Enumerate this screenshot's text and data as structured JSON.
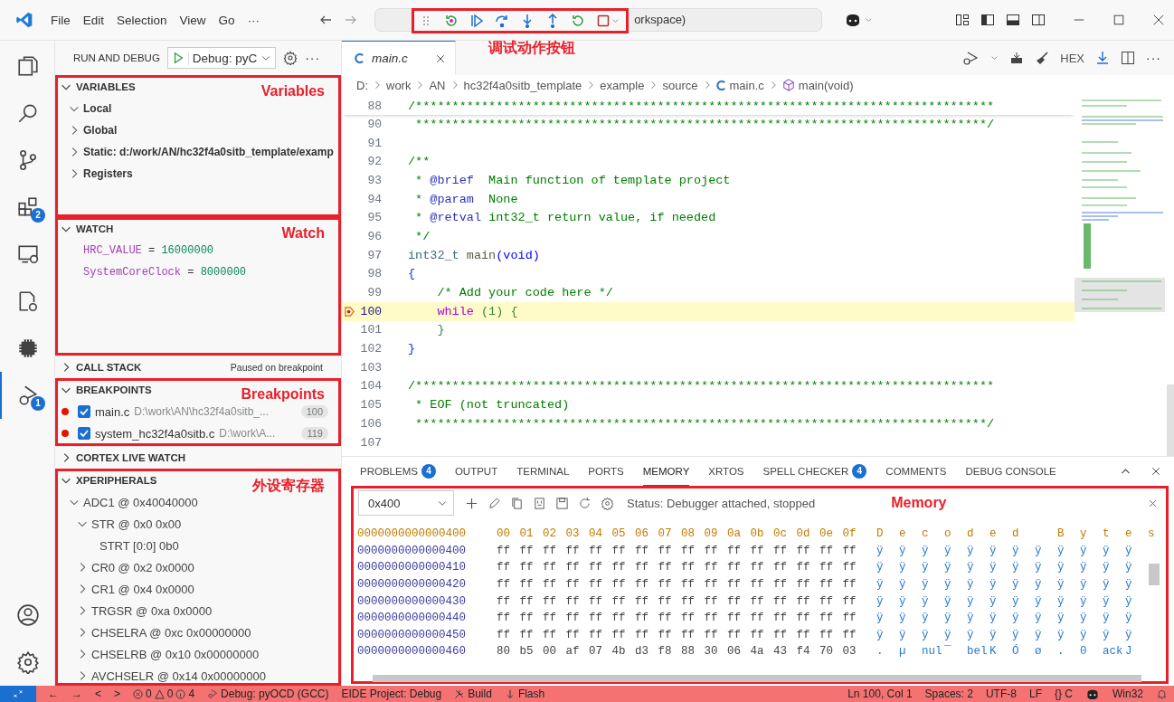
{
  "titlebar": {
    "menu": [
      "File",
      "Edit",
      "Selection",
      "View",
      "Go",
      "···"
    ],
    "command_center": "orkspace)",
    "annotation": "调试动作按钮",
    "debug_toolbar": [
      {
        "kind": "grip"
      },
      {
        "kind": "restart-dot"
      },
      {
        "kind": "continue"
      },
      {
        "kind": "step-over"
      },
      {
        "kind": "step-into"
      },
      {
        "kind": "step-out"
      },
      {
        "kind": "restart"
      },
      {
        "kind": "stop"
      }
    ]
  },
  "activity_bar": [
    {
      "kind": "explorer",
      "selected": false
    },
    {
      "kind": "search",
      "selected": false
    },
    {
      "kind": "source-control",
      "selected": false
    },
    {
      "kind": "extensions",
      "selected": false,
      "badge": "2"
    },
    {
      "kind": "remote",
      "selected": false
    },
    {
      "kind": "cpp-settings",
      "selected": false
    },
    {
      "kind": "chip",
      "selected": false
    },
    {
      "kind": "debug",
      "selected": true,
      "badge": "1"
    }
  ],
  "activity_bottom": [
    {
      "kind": "account"
    },
    {
      "kind": "settings"
    }
  ],
  "sidebar": {
    "title": "RUN AND DEBUG",
    "config": "Debug: pyC",
    "more": "···",
    "sections": [
      {
        "kind": "variables",
        "title": "VARIABLES",
        "expanded": true,
        "annotation": "Variables",
        "items": [
          {
            "label": "Local",
            "expanded": true
          },
          {
            "label": "Global",
            "expanded": false
          },
          {
            "label": "Static: d:/work/AN/hc32f4a0sitb_template/examp",
            "expanded": false
          },
          {
            "label": "Registers",
            "expanded": false
          }
        ]
      },
      {
        "kind": "watch",
        "title": "WATCH",
        "expanded": true,
        "annotation": "Watch",
        "items": [
          {
            "name": "HRC_VALUE",
            "operator": "=",
            "value": "16000000"
          },
          {
            "name": "SystemCoreClock",
            "operator": "=",
            "value": "8000000"
          }
        ]
      },
      {
        "kind": "callstack",
        "title": "CALL STACK",
        "expanded": false,
        "status": "Paused on breakpoint"
      },
      {
        "kind": "breakpoints",
        "title": "BREAKPOINTS",
        "expanded": true,
        "annotation": "Breakpoints",
        "items": [
          {
            "checked": true,
            "file": "main.c",
            "path": "D:\\work\\AN\\hc32f4a0sitb_...",
            "line": "100"
          },
          {
            "checked": true,
            "file": "system_hc32f4a0sitb.c",
            "path": "D:\\work\\A...",
            "line": "119"
          }
        ]
      },
      {
        "kind": "livewatch",
        "title": "CORTEX LIVE WATCH",
        "expanded": false
      },
      {
        "kind": "peripherals",
        "title": "XPERIPHERALS",
        "expanded": true,
        "annotation": "外设寄存器",
        "items": [
          {
            "label": "ADC1 @ 0x40040000",
            "expanded": true,
            "children": [
              {
                "label": "STR @ 0x0 0x00",
                "expanded": true,
                "children": [
                  {
                    "label": "STRT [0:0] 0b0"
                  }
                ]
              },
              {
                "label": "CR0 @ 0x2 0x0000",
                "expanded": false
              },
              {
                "label": "CR1 @ 0x4 0x0000",
                "expanded": false
              },
              {
                "label": "TRGSR @ 0xa 0x0000",
                "expanded": false
              },
              {
                "label": "CHSELRA @ 0xc 0x00000000",
                "expanded": false
              },
              {
                "label": "CHSELRB @ 0x10 0x00000000",
                "expanded": false
              },
              {
                "label": "AVCHSELR @ 0x14 0x00000000",
                "expanded": false
              }
            ]
          }
        ]
      }
    ]
  },
  "editor": {
    "tabs": [
      {
        "label": "main.c",
        "selected": true
      }
    ],
    "toolbar_text": "HEX",
    "more": "···",
    "breadcrumb": [
      {
        "kind": "folder",
        "text": "D:"
      },
      {
        "kind": "folder",
        "text": "work"
      },
      {
        "kind": "folder",
        "text": "AN"
      },
      {
        "kind": "folder",
        "text": "hc32f4a0sitb_template"
      },
      {
        "kind": "folder",
        "text": "example"
      },
      {
        "kind": "folder",
        "text": "source"
      },
      {
        "kind": "c-file",
        "text": "main.c"
      },
      {
        "kind": "function",
        "text": "main(void)"
      }
    ],
    "sticky": {
      "number": "88",
      "tokens": [
        {
          "kind": "comment",
          "text": "/*******************************************************************************"
        }
      ]
    },
    "lines": [
      {
        "number": "90",
        "current": false,
        "breakpoint": false,
        "tokens": [
          {
            "kind": "comment",
            "text": " ******************************************************************************/"
          }
        ]
      },
      {
        "number": "91",
        "current": false,
        "breakpoint": false
      },
      {
        "number": "92",
        "current": false,
        "breakpoint": false,
        "tokens": [
          {
            "kind": "comment",
            "text": "/**"
          }
        ]
      },
      {
        "number": "93",
        "current": false,
        "breakpoint": false,
        "tokens": [
          {
            "kind": "comment",
            "text": " * "
          },
          {
            "kind": "doctag",
            "text": "@brief"
          },
          {
            "kind": "comment",
            "text": "  Main function of template project"
          }
        ]
      },
      {
        "number": "94",
        "current": false,
        "breakpoint": false,
        "tokens": [
          {
            "kind": "comment",
            "text": " * "
          },
          {
            "kind": "doctag",
            "text": "@param"
          },
          {
            "kind": "comment",
            "text": "  None"
          }
        ]
      },
      {
        "number": "95",
        "current": false,
        "breakpoint": false,
        "tokens": [
          {
            "kind": "comment",
            "text": " * "
          },
          {
            "kind": "doctag",
            "text": "@retval"
          },
          {
            "kind": "comment",
            "text": " int32_t return value, if needed"
          }
        ]
      },
      {
        "number": "96",
        "current": false,
        "breakpoint": false,
        "tokens": [
          {
            "kind": "comment",
            "text": " */"
          }
        ]
      },
      {
        "number": "97",
        "current": false,
        "breakpoint": false,
        "tokens": [
          {
            "kind": "type",
            "text": "int32_t"
          },
          {
            "kind": "func",
            "text": " main"
          },
          {
            "kind": "keyword",
            "text": "(void)"
          }
        ]
      },
      {
        "number": "98",
        "current": false,
        "breakpoint": false,
        "tokens": [
          {
            "kind": "bracket",
            "text": "{"
          }
        ]
      },
      {
        "number": "99",
        "current": false,
        "breakpoint": false,
        "tokens": [
          {
            "kind": "comment",
            "text": "    /* Add your code here */"
          }
        ]
      },
      {
        "number": "100",
        "current": true,
        "breakpoint": true,
        "tokens": [
          {
            "kind": "control",
            "text": "    while"
          },
          {
            "kind": "number",
            "text": " (1) {"
          }
        ]
      },
      {
        "number": "101",
        "current": false,
        "breakpoint": false,
        "tokens": [
          {
            "kind": "number",
            "text": "    }"
          }
        ]
      },
      {
        "number": "102",
        "current": false,
        "breakpoint": false,
        "tokens": [
          {
            "kind": "bracket",
            "text": "}"
          }
        ]
      },
      {
        "number": "103",
        "current": false,
        "breakpoint": false
      },
      {
        "number": "104",
        "current": false,
        "breakpoint": false,
        "tokens": [
          {
            "kind": "comment",
            "text": "/*******************************************************************************"
          }
        ]
      },
      {
        "number": "105",
        "current": false,
        "breakpoint": false,
        "tokens": [
          {
            "kind": "comment",
            "text": " * EOF (not truncated)"
          }
        ]
      },
      {
        "number": "106",
        "current": false,
        "breakpoint": false,
        "tokens": [
          {
            "kind": "comment",
            "text": " ******************************************************************************/"
          }
        ]
      },
      {
        "number": "107",
        "current": false,
        "breakpoint": false
      }
    ]
  },
  "panel": {
    "tabs": [
      {
        "label": "PROBLEMS",
        "selected": false,
        "badge": "4"
      },
      {
        "label": "OUTPUT",
        "selected": false
      },
      {
        "label": "TERMINAL",
        "selected": false
      },
      {
        "label": "PORTS",
        "selected": false
      },
      {
        "label": "MEMORY",
        "selected": true
      },
      {
        "label": "XRTOS",
        "selected": false
      },
      {
        "label": "SPELL CHECKER",
        "selected": false,
        "badge": "4"
      },
      {
        "label": "COMMENTS",
        "selected": false
      },
      {
        "label": "DEBUG CONSOLE",
        "selected": false
      }
    ],
    "memory": {
      "address": "0x400",
      "status": "Status: Debugger attached, stopped",
      "annotation": "Memory",
      "header": {
        "address": "0000000000000400",
        "bytes": "00 01 02 03 04 05 06 07 08 09 0a 0b 0c 0d 0e 0f",
        "decoded": "Decoded Bytes"
      },
      "rows": [
        {
          "address": "0000000000000400",
          "bytes": "ff ff ff ff ff ff ff ff ff ff ff ff ff ff ff ff",
          "decoded": [
            "ÿ",
            "ÿ",
            "ÿ",
            "ÿ",
            "ÿ",
            "ÿ",
            "ÿ",
            "ÿ",
            "ÿ",
            "ÿ",
            "ÿ",
            "ÿ"
          ]
        },
        {
          "address": "0000000000000410",
          "bytes": "ff ff ff ff ff ff ff ff ff ff ff ff ff ff ff ff",
          "decoded": [
            "ÿ",
            "ÿ",
            "ÿ",
            "ÿ",
            "ÿ",
            "ÿ",
            "ÿ",
            "ÿ",
            "ÿ",
            "ÿ",
            "ÿ",
            "ÿ"
          ]
        },
        {
          "address": "0000000000000420",
          "bytes": "ff ff ff ff ff ff ff ff ff ff ff ff ff ff ff ff",
          "decoded": [
            "ÿ",
            "ÿ",
            "ÿ",
            "ÿ",
            "ÿ",
            "ÿ",
            "ÿ",
            "ÿ",
            "ÿ",
            "ÿ",
            "ÿ",
            "ÿ"
          ]
        },
        {
          "address": "0000000000000430",
          "bytes": "ff ff ff ff ff ff ff ff ff ff ff ff ff ff ff ff",
          "decoded": [
            "ÿ",
            "ÿ",
            "ÿ",
            "ÿ",
            "ÿ",
            "ÿ",
            "ÿ",
            "ÿ",
            "ÿ",
            "ÿ",
            "ÿ",
            "ÿ"
          ]
        },
        {
          "address": "0000000000000440",
          "bytes": "ff ff ff ff ff ff ff ff ff ff ff ff ff ff ff ff",
          "decoded": [
            "ÿ",
            "ÿ",
            "ÿ",
            "ÿ",
            "ÿ",
            "ÿ",
            "ÿ",
            "ÿ",
            "ÿ",
            "ÿ",
            "ÿ",
            "ÿ"
          ]
        },
        {
          "address": "0000000000000450",
          "bytes": "ff ff ff ff ff ff ff ff ff ff ff ff ff ff ff ff",
          "decoded": [
            "ÿ",
            "ÿ",
            "ÿ",
            "ÿ",
            "ÿ",
            "ÿ",
            "ÿ",
            "ÿ",
            "ÿ",
            "ÿ",
            "ÿ",
            "ÿ"
          ]
        },
        {
          "address": "0000000000000460",
          "bytes": "80 b5 00 af 07 4b d3 f8 88 30 06 4a 43 f4 70 03",
          "decoded": [
            ".",
            "µ",
            "nul",
            "¯",
            "bel",
            "K",
            "Ó",
            "ø",
            ".",
            "0",
            "ack",
            "J"
          ]
        }
      ]
    }
  },
  "status_bar": {
    "left": [
      {
        "kind": "remote"
      },
      {
        "kind": "text",
        "text": "←"
      },
      {
        "kind": "text",
        "text": "→"
      },
      {
        "kind": "text",
        "text": "<"
      },
      {
        "kind": "text",
        "text": ">"
      },
      {
        "kind": "problems",
        "errors": "0",
        "warnings": "0",
        "infos": "4"
      },
      {
        "kind": "debug",
        "text": "Debug: pyOCD (GCC)"
      },
      {
        "kind": "text",
        "text": "EIDE Project: Debug"
      },
      {
        "kind": "build",
        "text": "Build"
      },
      {
        "kind": "flash",
        "text": "Flash"
      }
    ],
    "right": [
      {
        "kind": "text",
        "text": "Ln 100, Col 1"
      },
      {
        "kind": "text",
        "text": "Spaces: 2"
      },
      {
        "kind": "text",
        "text": "UTF-8"
      },
      {
        "kind": "text",
        "text": "LF"
      },
      {
        "kind": "text",
        "text": "{} C"
      },
      {
        "kind": "copilot"
      },
      {
        "kind": "text",
        "text": "Win32"
      },
      {
        "kind": "bell"
      }
    ]
  }
}
